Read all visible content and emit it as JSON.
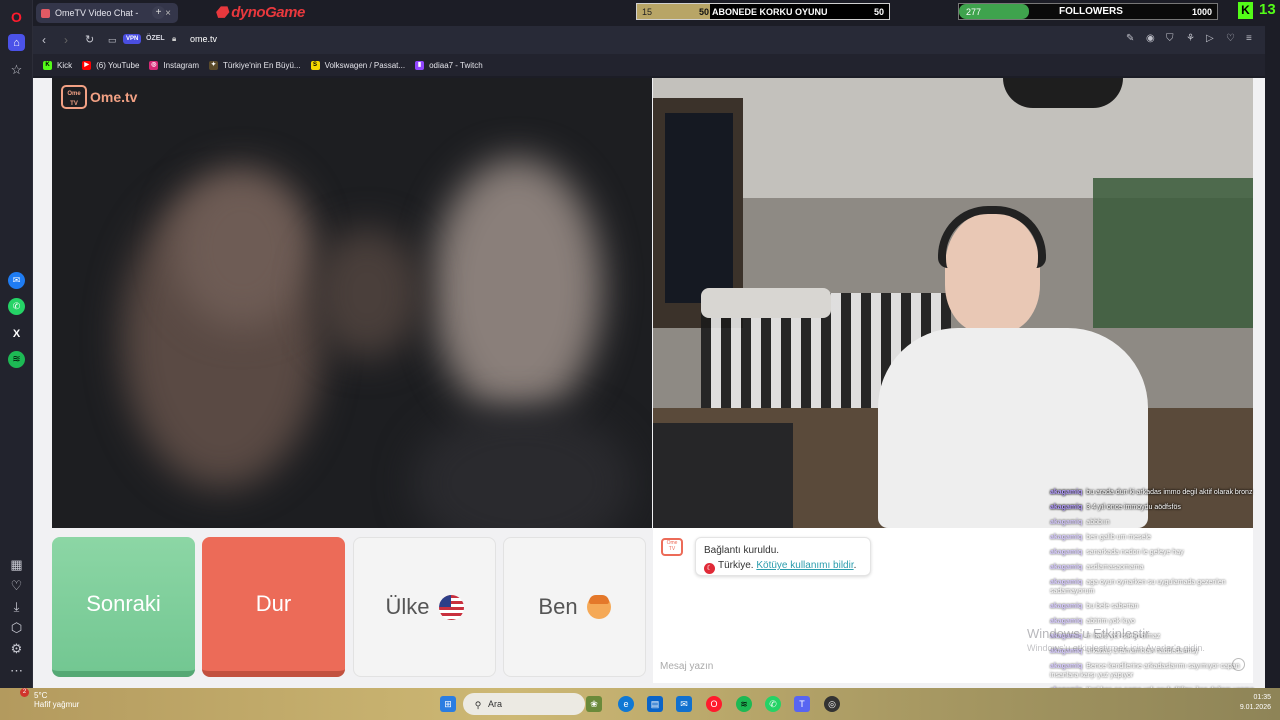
{
  "tab": {
    "title": "OmeTV Video Chat -"
  },
  "overlay": {
    "subscriber_goal": {
      "current": "15",
      "goal_marker": "50",
      "title": "ABONEDE KORKU OYUNU",
      "target": "50",
      "progress": 0.29
    },
    "followers_goal": {
      "current": "277",
      "title": "FOLLOWERS",
      "target": "1000",
      "progress": 0.27
    },
    "kick_count": "13",
    "kick_letter": "K"
  },
  "addressbar": {
    "vpn": "VPN",
    "private": "ÖZEL",
    "url": "ome.tv"
  },
  "bookmarks": [
    {
      "label": "Kick",
      "color": "#53fc18",
      "glyph": "K"
    },
    {
      "label": "(6) YouTube",
      "color": "#ff0000",
      "glyph": "▶"
    },
    {
      "label": "Instagram",
      "color": "#d62976",
      "glyph": "◎"
    },
    {
      "label": "Türkiye'nin En Büyü...",
      "color": "#5a4a2a",
      "glyph": "✦"
    },
    {
      "label": "Volkswagen / Passat...",
      "color": "#f5d800",
      "glyph": "S"
    },
    {
      "label": "odiaa7 - Twitch",
      "color": "#9146ff",
      "glyph": "▮"
    }
  ],
  "page": {
    "logo": "Ome.tv",
    "logo_small": "Ome TV",
    "buttons": {
      "next": "Sonraki",
      "stop": "Dur",
      "country": "Ülke",
      "me": "Ben"
    },
    "chat": {
      "status": "Bağlantı kuruldu.",
      "country": "Türkiye.",
      "report": "Kötüye kullanımı bildir",
      "report_suffix": ".",
      "placeholder": "Mesaj yazın"
    }
  },
  "twitch_chat": [
    {
      "user": "akagamiq",
      "text": "bu arada dun ki arkadas immo degil aktif olarak bronz"
    },
    {
      "user": "akagamiq",
      "text": "3 4 yıl once immoydu aödfsfös"
    },
    {
      "user": "akagamiq",
      "text": "abbbıın"
    },
    {
      "user": "akagamiq",
      "text": "ben galib um mesele"
    },
    {
      "user": "akagamiq",
      "text": "sanarkada nedon le geleye hay"
    },
    {
      "user": "akagamiq",
      "text": "asdlamasaomama"
    },
    {
      "user": "akagamiq",
      "text": "aga oyun oynarken su uygulamada gezenlen sadamayorum"
    },
    {
      "user": "akagamiq",
      "text": "bu bele sabertan"
    },
    {
      "user": "akagamiq",
      "text": "abtirim yok kıyo"
    },
    {
      "user": "akagamiq",
      "text": "in baltz yor sorun olmaz"
    },
    {
      "user": "akagamiq",
      "text": "arkadaş artamamolan naddedarmsy"
    },
    {
      "user": "akagamiq",
      "text": "Bence kendilerine arkadaslarımı sayımıyor capan insanlara karşı yuz yapıyor"
    },
    {
      "user": "akagamiq",
      "text": "Kral ben no name yok osuh döfterı ikse değem yapma"
    }
  ],
  "windows_activation": {
    "title": "Windows'u Etkinleştir",
    "subtitle": "Windows'u etkinleştirmek için Ayarlar'a gidin."
  },
  "taskbar": {
    "weather_temp": "5°C",
    "weather_text": "Hafif yağmur",
    "weather_badge": "2",
    "search": "Ara",
    "time": "01:35",
    "date": "9.01.2026"
  }
}
